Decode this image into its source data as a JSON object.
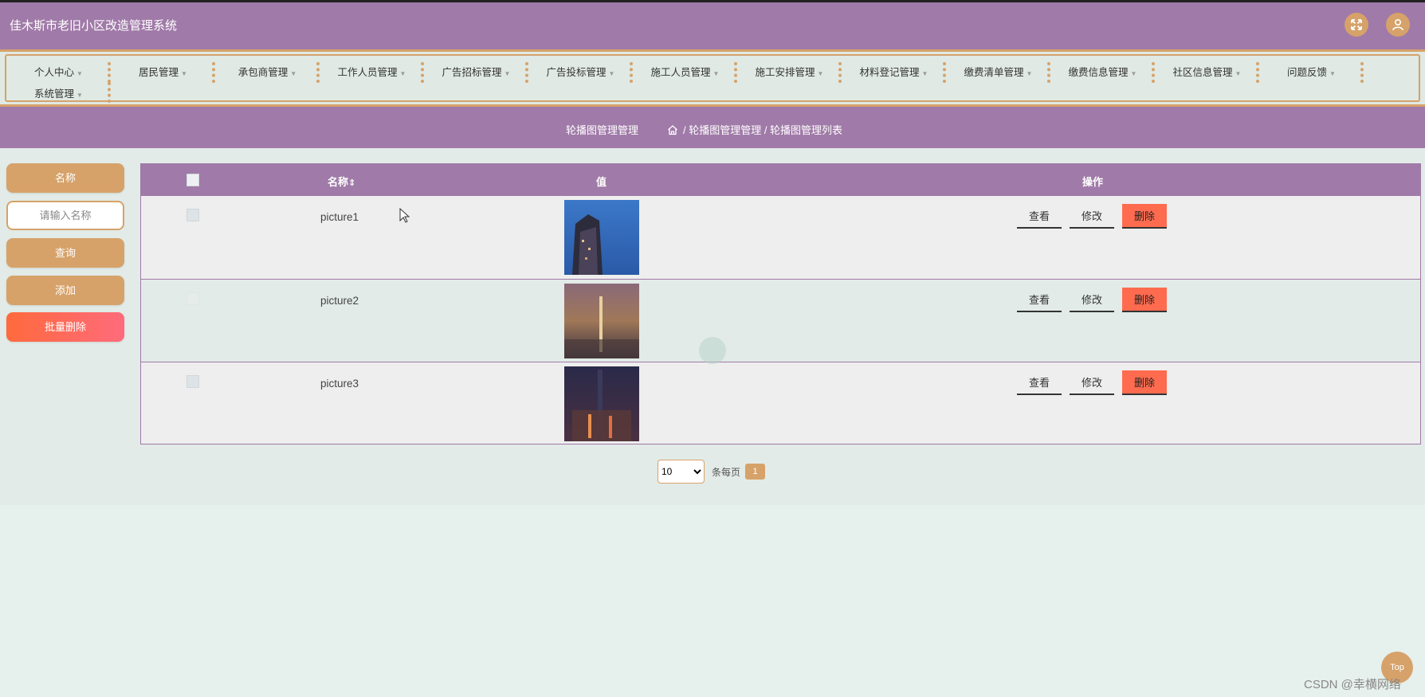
{
  "header": {
    "title": "佳木斯市老旧小区改造管理系统",
    "fullscreen_icon": "expand-icon",
    "user_icon": "user-icon"
  },
  "nav": {
    "items": [
      {
        "label": "个人中心"
      },
      {
        "label": "居民管理"
      },
      {
        "label": "承包商管理"
      },
      {
        "label": "工作人员管理"
      },
      {
        "label": "广告招标管理"
      },
      {
        "label": "广告投标管理"
      },
      {
        "label": "施工人员管理"
      },
      {
        "label": "施工安排管理"
      },
      {
        "label": "材料登记管理"
      },
      {
        "label": "缴费清单管理"
      },
      {
        "label": "缴费信息管理"
      },
      {
        "label": "社区信息管理"
      },
      {
        "label": "问题反馈"
      },
      {
        "label": "系统管理"
      }
    ]
  },
  "breadcrumb": {
    "page_title": "轮播图管理管理",
    "path": "/ 轮播图管理管理 / 轮播图管理列表"
  },
  "sidebar": {
    "name_label": "名称",
    "name_placeholder": "请输入名称",
    "search_label": "查询",
    "add_label": "添加",
    "batch_delete_label": "批量删除"
  },
  "table": {
    "columns": {
      "name": "名称",
      "sort_glyph": "⇕",
      "value": "值",
      "actions": "操作"
    },
    "rows": [
      {
        "name": "picture1"
      },
      {
        "name": "picture2"
      },
      {
        "name": "picture3"
      }
    ],
    "actions": {
      "view": "查看",
      "edit": "修改",
      "delete": "删除"
    }
  },
  "pager": {
    "page_size": "10",
    "page_size_options": [
      "10"
    ],
    "per_page_label": "条每页",
    "current_page": "1"
  },
  "misc": {
    "top_button": "Top",
    "watermark": "CSDN @幸横网络"
  },
  "colors": {
    "primary": "#a07aa8",
    "accent": "#d6a26a",
    "danger": "#ff6b4f",
    "background": "#e6f0ec"
  }
}
